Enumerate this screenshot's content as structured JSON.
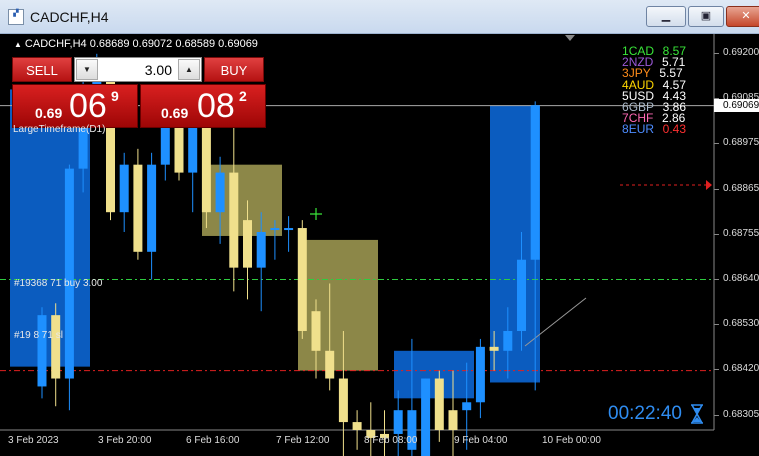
{
  "window": {
    "title": "CADCHF,H4",
    "icon": "metatrader-chart-icon",
    "min_icon": "minimize-icon",
    "max_icon": "restore-icon",
    "close_icon": "close-icon"
  },
  "chart": {
    "header": "CADCHF,H4  0.68689 0.69072 0.68589 0.69069",
    "indicator_label": "LargeTimeframe(D1)"
  },
  "trade_panel": {
    "sell_label": "SELL",
    "buy_label": "BUY",
    "lot_value": "3.00",
    "sell_price": {
      "prefix": "0.69",
      "big": "06",
      "sup": "9"
    },
    "buy_price": {
      "prefix": "0.69",
      "big": "08",
      "sup": "2"
    }
  },
  "orders": {
    "buy_label": "#19368   71 buy 3.00",
    "sl_label": "#19   8   71 sl"
  },
  "strength": [
    {
      "rank": "1",
      "code": "CAD",
      "value": "8.57",
      "code_color": "#39e639",
      "value_color": "#39e639"
    },
    {
      "rank": "2",
      "code": "NZD",
      "value": "5.71",
      "code_color": "#9b59d6",
      "value_color": "#ffffff"
    },
    {
      "rank": "3",
      "code": "JPY",
      "value": "5.57",
      "code_color": "#ff8c1a",
      "value_color": "#ffffff"
    },
    {
      "rank": "4",
      "code": "AUD",
      "value": "4.57",
      "code_color": "#ffd700",
      "value_color": "#ffffff"
    },
    {
      "rank": "5",
      "code": "USD",
      "value": "4.43",
      "code_color": "#ffffff",
      "value_color": "#ffffff"
    },
    {
      "rank": "6",
      "code": "GBP",
      "value": "3.86",
      "code_color": "#aab8c8",
      "value_color": "#ffffff"
    },
    {
      "rank": "7",
      "code": "CHF",
      "value": "2.86",
      "code_color": "#ff69b4",
      "value_color": "#ffffff"
    },
    {
      "rank": "8",
      "code": "EUR",
      "value": "0.43",
      "code_color": "#4d8cff",
      "value_color": "#ff3030"
    }
  ],
  "price_axis": [
    "0.69200",
    "0.69085",
    "0.68975",
    "0.68865",
    "0.68755",
    "0.68640",
    "0.68530",
    "0.68420",
    "0.68305"
  ],
  "current_price": "0.69069",
  "time_axis": [
    "3 Feb 2023",
    "3 Feb 20:00",
    "6 Feb 16:00",
    "7 Feb 12:00",
    "8 Feb 08:00",
    "9 Feb 04:00",
    "10 Feb 00:00"
  ],
  "timer": "00:22:40",
  "colors": {
    "bull": "#1e90ff",
    "bear": "#f0e08c",
    "box_blue": "#0b5cbf",
    "box_olive": "#8c8748"
  },
  "chart_data": {
    "type": "candlestick",
    "symbol": "CADCHF",
    "timeframe": "H4",
    "ylim": [
      0.6825,
      0.6925
    ],
    "candles": [
      {
        "o": 0.6836,
        "h": 0.6856,
        "l": 0.6833,
        "c": 0.6854,
        "dir": "up"
      },
      {
        "o": 0.6854,
        "h": 0.6857,
        "l": 0.6831,
        "c": 0.6838,
        "dir": "down"
      },
      {
        "o": 0.6838,
        "h": 0.6892,
        "l": 0.683,
        "c": 0.6891,
        "dir": "up"
      },
      {
        "o": 0.6891,
        "h": 0.6915,
        "l": 0.6885,
        "c": 0.6912,
        "dir": "up"
      },
      {
        "o": 0.6912,
        "h": 0.692,
        "l": 0.6905,
        "c": 0.6915,
        "dir": "up"
      },
      {
        "o": 0.6915,
        "h": 0.6918,
        "l": 0.6878,
        "c": 0.688,
        "dir": "down"
      },
      {
        "o": 0.688,
        "h": 0.6895,
        "l": 0.6875,
        "c": 0.6892,
        "dir": "up"
      },
      {
        "o": 0.6892,
        "h": 0.6896,
        "l": 0.6868,
        "c": 0.687,
        "dir": "down"
      },
      {
        "o": 0.687,
        "h": 0.6895,
        "l": 0.6863,
        "c": 0.6892,
        "dir": "up"
      },
      {
        "o": 0.6892,
        "h": 0.6912,
        "l": 0.6888,
        "c": 0.691,
        "dir": "up"
      },
      {
        "o": 0.691,
        "h": 0.6912,
        "l": 0.6888,
        "c": 0.689,
        "dir": "down"
      },
      {
        "o": 0.689,
        "h": 0.6906,
        "l": 0.688,
        "c": 0.6902,
        "dir": "up"
      },
      {
        "o": 0.6902,
        "h": 0.6905,
        "l": 0.6876,
        "c": 0.688,
        "dir": "down"
      },
      {
        "o": 0.688,
        "h": 0.6894,
        "l": 0.6872,
        "c": 0.689,
        "dir": "up"
      },
      {
        "o": 0.689,
        "h": 0.691,
        "l": 0.686,
        "c": 0.6866,
        "dir": "down"
      },
      {
        "o": 0.6866,
        "h": 0.6883,
        "l": 0.6858,
        "c": 0.6878,
        "dir": "down"
      },
      {
        "o": 0.6866,
        "h": 0.688,
        "l": 0.6855,
        "c": 0.6875,
        "dir": "up"
      },
      {
        "o": 0.6876,
        "h": 0.6878,
        "l": 0.6868,
        "c": 0.6876,
        "dir": "up"
      },
      {
        "o": 0.6876,
        "h": 0.6879,
        "l": 0.687,
        "c": 0.6876,
        "dir": "up"
      },
      {
        "o": 0.6876,
        "h": 0.6878,
        "l": 0.6848,
        "c": 0.685,
        "dir": "down"
      },
      {
        "o": 0.6855,
        "h": 0.6858,
        "l": 0.6838,
        "c": 0.6845,
        "dir": "down"
      },
      {
        "o": 0.6845,
        "h": 0.6862,
        "l": 0.6835,
        "c": 0.6838,
        "dir": "down"
      },
      {
        "o": 0.6838,
        "h": 0.685,
        "l": 0.6818,
        "c": 0.6827,
        "dir": "down"
      },
      {
        "o": 0.6827,
        "h": 0.683,
        "l": 0.682,
        "c": 0.6825,
        "dir": "down"
      },
      {
        "o": 0.6825,
        "h": 0.6832,
        "l": 0.6812,
        "c": 0.6823,
        "dir": "down"
      },
      {
        "o": 0.6823,
        "h": 0.683,
        "l": 0.6817,
        "c": 0.6824,
        "dir": "down"
      },
      {
        "o": 0.6824,
        "h": 0.6835,
        "l": 0.6812,
        "c": 0.683,
        "dir": "up"
      },
      {
        "o": 0.683,
        "h": 0.6848,
        "l": 0.681,
        "c": 0.682,
        "dir": "up"
      },
      {
        "o": 0.6818,
        "h": 0.6838,
        "l": 0.6815,
        "c": 0.6838,
        "dir": "up"
      },
      {
        "o": 0.6838,
        "h": 0.684,
        "l": 0.6822,
        "c": 0.6825,
        "dir": "down"
      },
      {
        "o": 0.6825,
        "h": 0.684,
        "l": 0.6818,
        "c": 0.683,
        "dir": "down"
      },
      {
        "o": 0.683,
        "h": 0.6842,
        "l": 0.682,
        "c": 0.6832,
        "dir": "up"
      },
      {
        "o": 0.6832,
        "h": 0.6848,
        "l": 0.6828,
        "c": 0.6846,
        "dir": "up"
      },
      {
        "o": 0.6846,
        "h": 0.685,
        "l": 0.684,
        "c": 0.6845,
        "dir": "down"
      },
      {
        "o": 0.6845,
        "h": 0.6856,
        "l": 0.6838,
        "c": 0.685,
        "dir": "up"
      },
      {
        "o": 0.685,
        "h": 0.6875,
        "l": 0.6845,
        "c": 0.6868,
        "dir": "up"
      },
      {
        "o": 0.6868,
        "h": 0.6908,
        "l": 0.6835,
        "c": 0.6907,
        "dir": "up"
      }
    ],
    "levels": [
      {
        "name": "buy 3.00",
        "price": 0.6863,
        "color": "#2ecc40"
      },
      {
        "name": "sl",
        "price": 0.684,
        "color": "#e02020"
      },
      {
        "name": "bid",
        "price": 0.69069,
        "color": "#aaaaaa"
      }
    ]
  }
}
